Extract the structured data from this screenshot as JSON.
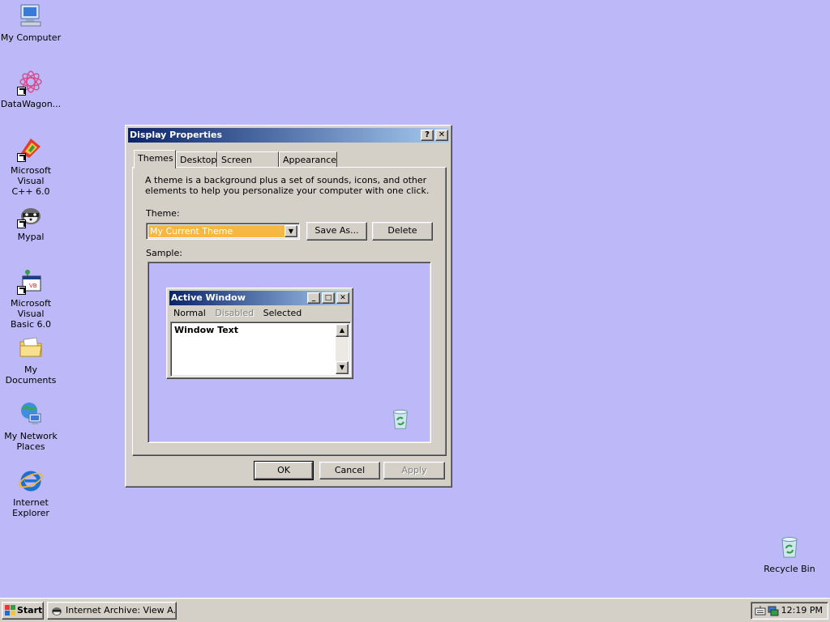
{
  "desktop": {
    "background": "#bdb8f7",
    "icons": [
      {
        "label": "My Computer",
        "icon": "computer-icon"
      },
      {
        "label": "DataWagon...",
        "icon": "datawagon-icon"
      },
      {
        "label": "Microsoft Visual\nC++ 6.0",
        "icon": "visual-cpp-icon"
      },
      {
        "label": "Mypal",
        "icon": "mypal-icon"
      },
      {
        "label": "Microsoft Visual\nBasic 6.0",
        "icon": "visual-basic-icon"
      },
      {
        "label": "My Documents",
        "icon": "folder-icon"
      },
      {
        "label": "My Network\nPlaces",
        "icon": "network-icon"
      },
      {
        "label": "Internet\nExplorer",
        "icon": "internet-explorer-icon"
      },
      {
        "label": "Recycle Bin",
        "icon": "recycle-bin-icon"
      }
    ]
  },
  "dialog": {
    "title": "Display Properties",
    "help_glyph": "?",
    "close_glyph": "✕",
    "tabs": [
      {
        "label": "Themes",
        "active": true
      },
      {
        "label": "Desktop",
        "active": false
      },
      {
        "label": "Screen Saver",
        "active": false
      },
      {
        "label": "Appearance",
        "active": false
      }
    ],
    "description": "A theme is a background plus a set of sounds, icons, and other elements to help you personalize your computer with one click.",
    "theme_label": "Theme:",
    "theme_value": "My Current Theme",
    "save_as_label": "Save As...",
    "delete_label": "Delete",
    "sample_label": "Sample:",
    "sample": {
      "window_title": "Active Window",
      "menu": [
        "Normal",
        "Disabled",
        "Selected"
      ],
      "window_text": "Window Text"
    },
    "ok_label": "OK",
    "cancel_label": "Cancel",
    "apply_label": "Apply"
  },
  "taskbar": {
    "start_label": "Start",
    "task_label": "Internet Archive: View A...",
    "clock": "12:19 PM"
  }
}
